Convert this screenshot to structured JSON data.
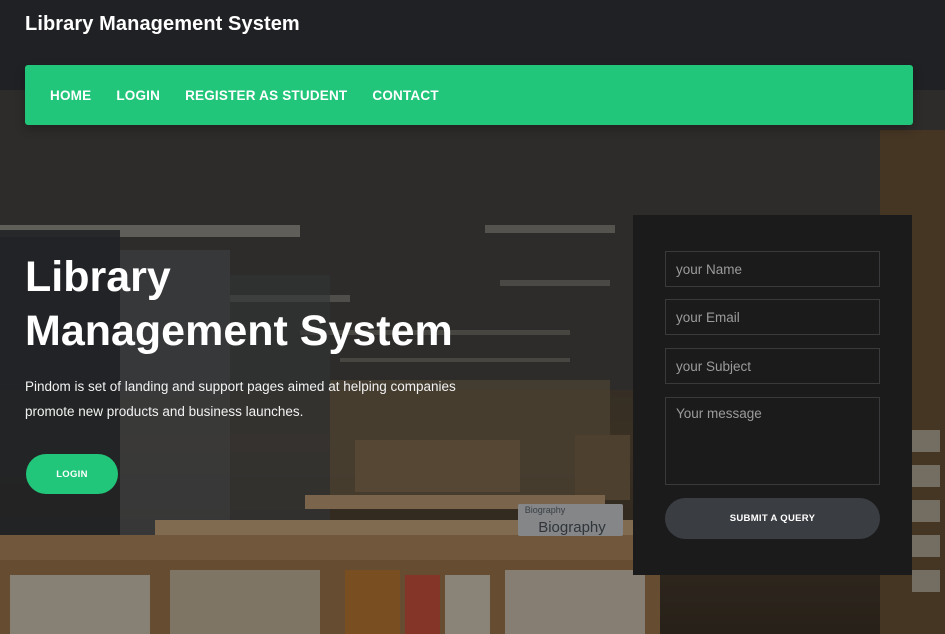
{
  "header": {
    "brand": "Library Management System"
  },
  "nav": {
    "items": [
      "HOME",
      "LOGIN",
      "REGISTER AS STUDENT",
      "CONTACT"
    ]
  },
  "hero": {
    "title_line1": "Library",
    "title_line2": "Management System",
    "description": "Pindom is set of landing and support pages aimed at helping companies promote new products and business launches.",
    "button_label": "LOGIN",
    "signs": [
      "Biography",
      "Biography"
    ]
  },
  "contact_form": {
    "name_placeholder": "your Name",
    "email_placeholder": "your Email",
    "subject_placeholder": "your Subject",
    "message_placeholder": "Your message",
    "submit_label": "SUBMIT A QUERY"
  },
  "colors": {
    "accent": "#22c67a",
    "header_bg": "#202124",
    "panel_bg": "#1b1b1c",
    "submit_bg": "#3a3d42"
  }
}
